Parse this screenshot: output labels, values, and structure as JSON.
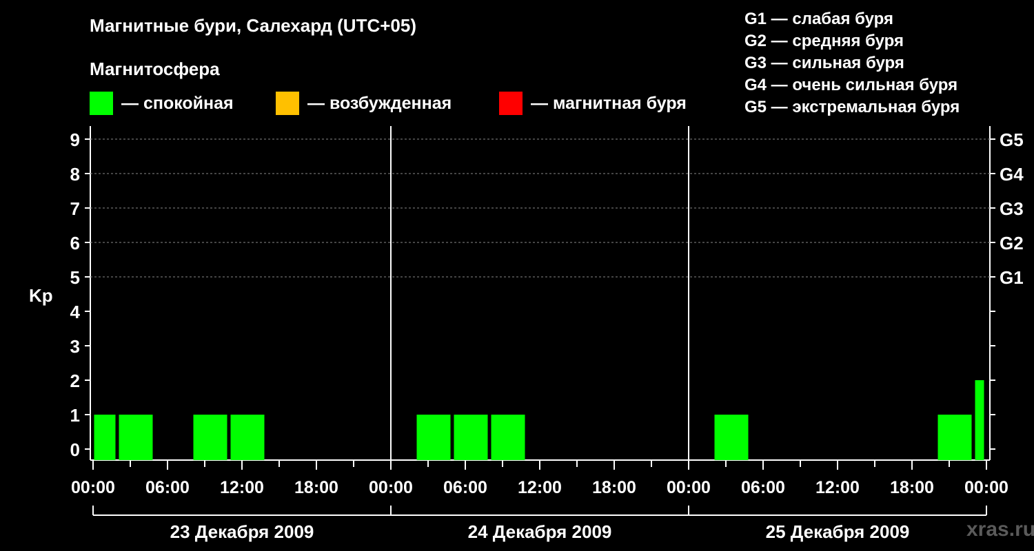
{
  "header": {
    "title": "Магнитные бури, Салехард (UTC+05)",
    "subtitle": "Магнитосфера"
  },
  "legend": [
    {
      "label": "— спокойная",
      "color": "#00ff00"
    },
    {
      "label": "— возбужденная",
      "color": "#ffc000"
    },
    {
      "label": "— магнитная буря",
      "color": "#ff0000"
    }
  ],
  "g_legend": [
    "G1 — слабая буря",
    "G2 — средняя буря",
    "G3 — сильная буря",
    "G4 — очень сильная буря",
    "G5 — экстремальная буря"
  ],
  "watermark": "xras.ru",
  "chart_data": {
    "type": "bar",
    "ylabel": "Kp",
    "ylim": [
      0,
      9
    ],
    "y_ticks": [
      "0",
      "1",
      "2",
      "3",
      "4",
      "5",
      "6",
      "7",
      "8",
      "9"
    ],
    "g_levels": [
      {
        "label": "G1",
        "kp": 5
      },
      {
        "label": "G2",
        "kp": 6
      },
      {
        "label": "G3",
        "kp": 7
      },
      {
        "label": "G4",
        "kp": 8
      },
      {
        "label": "G5",
        "kp": 9
      }
    ],
    "x_ticks": [
      "00:00",
      "06:00",
      "12:00",
      "18:00",
      "00:00",
      "06:00",
      "12:00",
      "18:00",
      "00:00",
      "06:00",
      "12:00",
      "18:00",
      "00:00"
    ],
    "days": [
      "23 Декабря 2009",
      "24 Декабря 2009",
      "25 Декабря 2009"
    ],
    "grid": true,
    "series": [
      {
        "values": [
          {
            "day": 0,
            "start_hour": 0,
            "end_hour": 2,
            "kp": 1
          },
          {
            "day": 0,
            "start_hour": 2,
            "end_hour": 5,
            "kp": 1
          },
          {
            "day": 0,
            "start_hour": 8,
            "end_hour": 11,
            "kp": 1
          },
          {
            "day": 0,
            "start_hour": 11,
            "end_hour": 14,
            "kp": 1
          },
          {
            "day": 1,
            "start_hour": 2,
            "end_hour": 5,
            "kp": 1
          },
          {
            "day": 1,
            "start_hour": 5,
            "end_hour": 8,
            "kp": 1
          },
          {
            "day": 1,
            "start_hour": 8,
            "end_hour": 11,
            "kp": 1
          },
          {
            "day": 2,
            "start_hour": 2,
            "end_hour": 5,
            "kp": 1
          },
          {
            "day": 2,
            "start_hour": 20,
            "end_hour": 23,
            "kp": 1
          },
          {
            "day": 2,
            "start_hour": 23,
            "end_hour": 24,
            "kp": 2
          }
        ]
      }
    ],
    "bar_color": "#00ff00"
  }
}
